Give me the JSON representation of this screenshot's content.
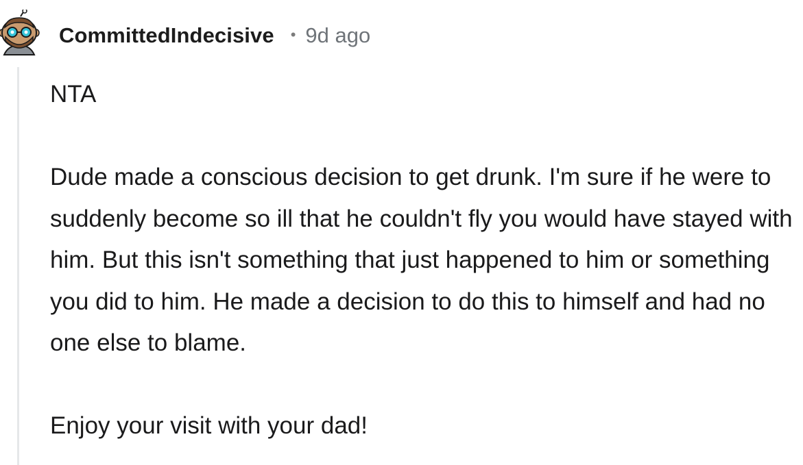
{
  "comment": {
    "username": "CommittedIndecisive",
    "separator": "•",
    "timestamp": "9d ago",
    "avatar": "reddit-snoo-avatar-icon",
    "paragraphs": [
      "NTA",
      "Dude made a conscious decision to get drunk. I'm sure if he were to suddenly become so ill that he couldn't fly you would have stayed with him. But this isn't something that just happened to him or something you did to him. He made a decision to do this to himself and had no one else to blame.",
      "Enjoy your visit with your dad!"
    ]
  },
  "colors": {
    "username": "#1c1c1c",
    "timestamp": "#6f7479",
    "thread_line": "#e5e7e9",
    "avatar_skin": "#c89a6e",
    "avatar_glasses": "#35c4d9"
  }
}
